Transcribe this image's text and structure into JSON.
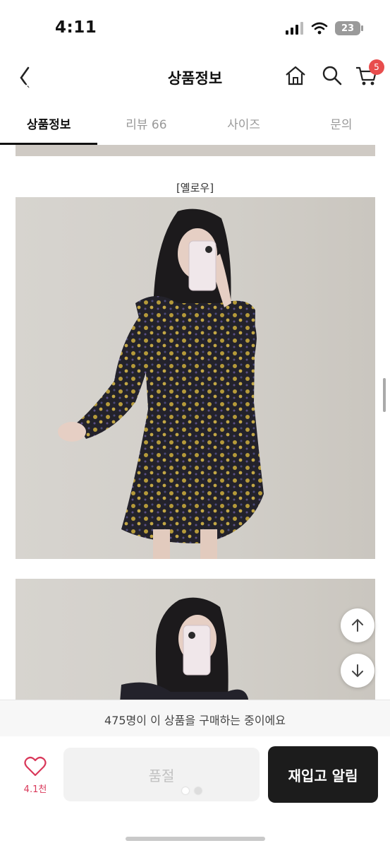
{
  "status_bar": {
    "time": "4:11",
    "battery": "23"
  },
  "header": {
    "title": "상품정보",
    "cart_count": "5"
  },
  "tabs": [
    {
      "label": "상품정보",
      "active": true
    },
    {
      "label": "리뷰 66",
      "active": false
    },
    {
      "label": "사이즈",
      "active": false
    },
    {
      "label": "문의",
      "active": false
    }
  ],
  "content": {
    "color_label": "[옐로우]"
  },
  "purchase_banner": "475명이 이 상품을 구매하는 중이에요",
  "bottom_bar": {
    "wish_count": "4.1천",
    "soldout_label": "품절",
    "restock_label": "재입고 알림"
  },
  "colors": {
    "accent": "#e84d4d",
    "wish": "#d9385a",
    "dark_button": "#1c1c1c"
  }
}
